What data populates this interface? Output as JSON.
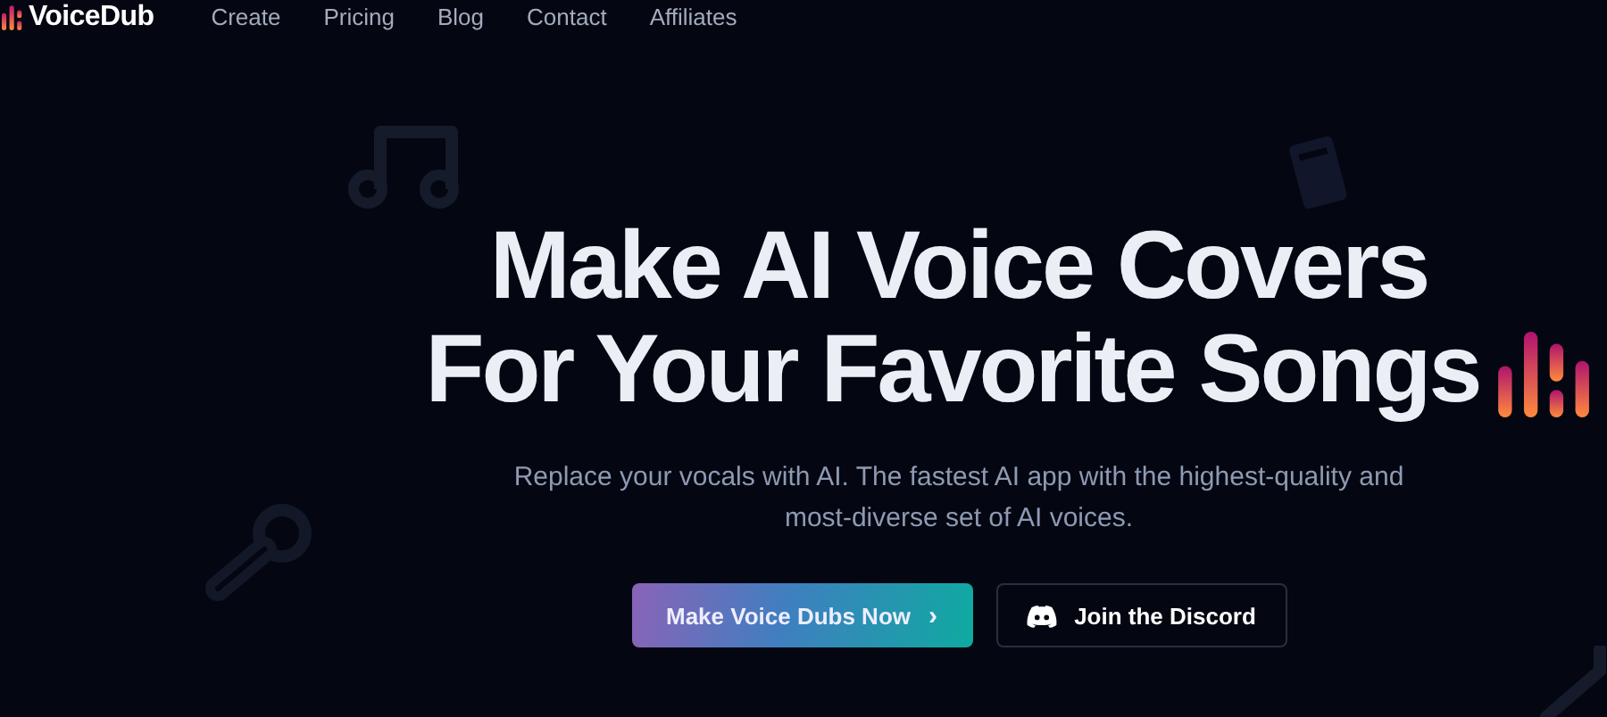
{
  "header": {
    "logo": "VoiceDub",
    "nav": [
      "Create",
      "Pricing",
      "Blog",
      "Contact",
      "Affiliates"
    ]
  },
  "hero": {
    "title_lines": [
      "Make AI Voice Covers",
      "For Your Favorite Songs"
    ],
    "subtitle_lines": [
      "Replace your vocals with AI. The fastest AI app with the highest-quality and",
      "most-diverse set of AI voices."
    ],
    "buttons": [
      {
        "kind": "primary",
        "label": "Make Voice Dubs Now",
        "icon": "›"
      },
      {
        "kind": "secondary",
        "label": "Join the Discord"
      }
    ]
  }
}
